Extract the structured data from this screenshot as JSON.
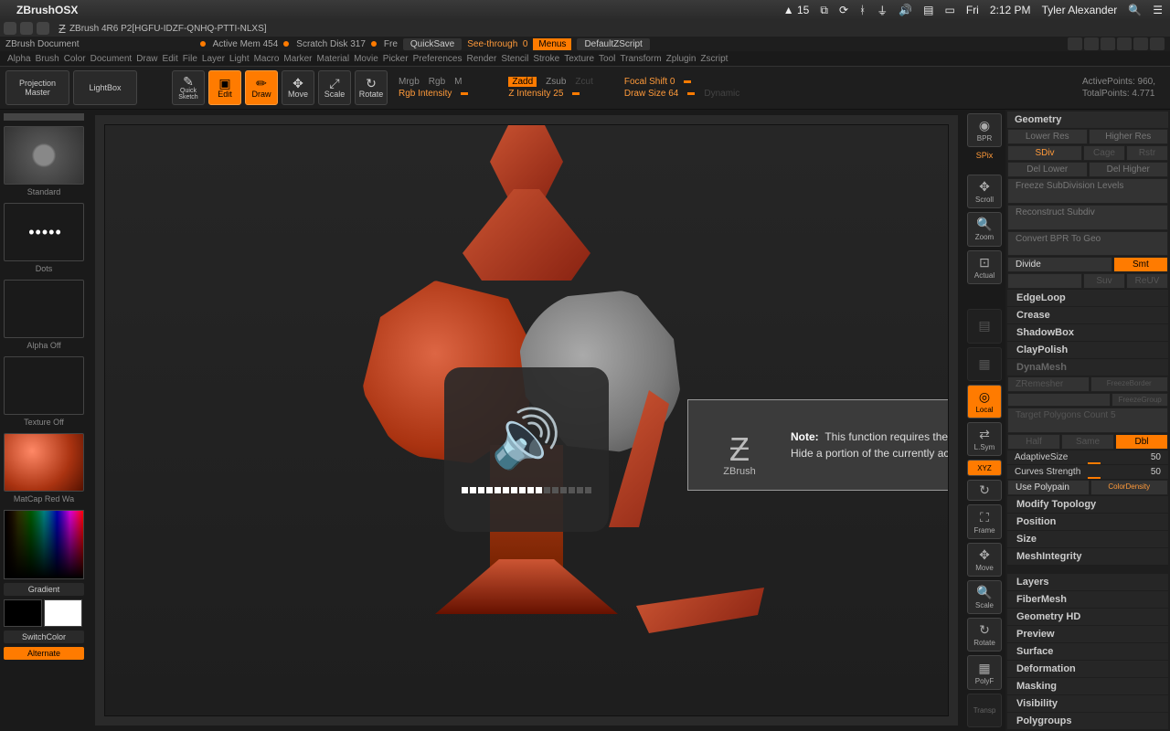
{
  "mac": {
    "app": "ZBrushOSX",
    "adobe": "15",
    "day": "Fri",
    "time": "2:12 PM",
    "user": "Tyler Alexander"
  },
  "title": {
    "app": "ZBrush 4R6 P2[HGFU-IDZF-QNHQ-PTTI-NLXS]",
    "doc": "ZBrush Document"
  },
  "stats": {
    "mem": "Active Mem 454",
    "scratch": "Scratch Disk 317",
    "free": "Fre",
    "quicksave": "QuickSave",
    "see": "See-through",
    "seeval": "0",
    "menus": "Menus",
    "script": "DefaultZScript"
  },
  "menus": [
    "Alpha",
    "Brush",
    "Color",
    "Document",
    "Draw",
    "Edit",
    "File",
    "Layer",
    "Light",
    "Macro",
    "Marker",
    "Material",
    "Movie",
    "Picker",
    "Preferences",
    "Render",
    "Stencil",
    "Stroke",
    "Texture",
    "Tool",
    "Transform",
    "Zplugin",
    "Zscript"
  ],
  "toolbar": {
    "proj": "Projection Master",
    "light": "LightBox",
    "quick": "Quick Sketch",
    "edit": "Edit",
    "draw": "Draw",
    "move": "Move",
    "scale": "Scale",
    "rotate": "Rotate",
    "mrgb": "Mrgb",
    "rgb": "Rgb",
    "m": "M",
    "zadd": "Zadd",
    "zsub": "Zsub",
    "zcut": "Zcut",
    "rgbint": "Rgb Intensity",
    "zint": "Z Intensity",
    "zintval": "25",
    "focal": "Focal Shift",
    "focalval": "0",
    "drawsize": "Draw Size",
    "drawsizeval": "64",
    "dynamic": "Dynamic",
    "active": "ActivePoints:",
    "activeval": "960,",
    "total": "TotalPoints:",
    "totalval": "4.771"
  },
  "left": {
    "standard": "Standard",
    "dots": "Dots",
    "alphaoff": "Alpha Off",
    "texoff": "Texture Off",
    "matcap": "MatCap Red Wa",
    "gradient": "Gradient",
    "switch": "SwitchColor",
    "alt": "Alternate"
  },
  "rtool": {
    "bpr": "BPR",
    "spix": "SPix",
    "scroll": "Scroll",
    "zoom": "Zoom",
    "actual": "Actual",
    "persp": "Persp",
    "floor": "Floor",
    "local": "Local",
    "lsym": "L.Sym",
    "xyz": "XYZ",
    "frame": "Frame",
    "move": "Move",
    "scale": "Scale",
    "rotate": "Rotate",
    "polyf": "PolyF",
    "transp": "Transp"
  },
  "rp": {
    "geometry": "Geometry",
    "lowres": "Lower Res",
    "highres": "Higher Res",
    "sdiv": "SDiv",
    "cage": "Cage",
    "rstr": "Rstr",
    "dellower": "Del Lower",
    "delhigher": "Del Higher",
    "freeze": "Freeze SubDivision Levels",
    "recon": "Reconstruct Subdiv",
    "convbpr": "Convert BPR To Geo",
    "divide": "Divide",
    "smt": "Smt",
    "suv": "Suv",
    "reuv": "ReUV",
    "edgeloop": "EdgeLoop",
    "crease": "Crease",
    "shadowbox": "ShadowBox",
    "claypolish": "ClayPolish",
    "dynamesh": "DynaMesh",
    "zremesher": "ZRemesher",
    "freezeborder": "FreezeBorder",
    "freezegroup": "FreezeGroup",
    "target": "Target Polygons Count 5",
    "half": "Half",
    "same": "Same",
    "double": "Dbl",
    "adaptive": "AdaptiveSize",
    "adaptiveval": "50",
    "curves": "Curves Strength",
    "curvesval": "50",
    "usepolypaint": "Use Polypain",
    "colordensity": "ColorDensity",
    "modtopo": "Modify Topology",
    "position": "Position",
    "size": "Size",
    "meshint": "MeshIntegrity",
    "layers": "Layers",
    "fiber": "FiberMesh",
    "geohd": "Geometry HD",
    "preview": "Preview",
    "surface": "Surface",
    "deform": "Deformation",
    "masking": "Masking",
    "visibility": "Visibility",
    "polygroups": "Polygroups"
  },
  "tooltip": {
    "note": "Note:",
    "text1": "This function requires the mesh to be partially hidden.",
    "text2": "Hide a portion of the currently active mesh and and try again.",
    "brand": "ZBrush"
  },
  "vol": {
    "level": 10,
    "max": 16
  }
}
